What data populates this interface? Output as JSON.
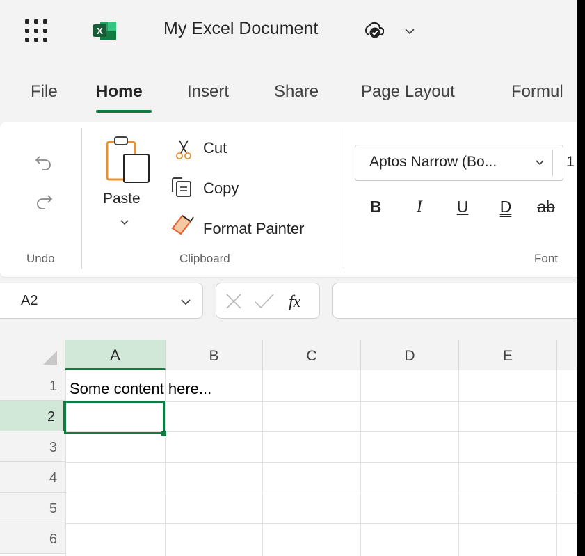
{
  "app": {
    "name": "Excel",
    "icon": "excel-logo-icon",
    "document_title": "My Excel Document",
    "accent_color": "#107c41"
  },
  "menu": {
    "tabs": [
      {
        "label": "File"
      },
      {
        "label": "Home",
        "active": true
      },
      {
        "label": "Insert"
      },
      {
        "label": "Share"
      },
      {
        "label": "Page Layout"
      },
      {
        "label": "Formul"
      }
    ]
  },
  "ribbon": {
    "undo_group": {
      "label": "Undo",
      "undo_icon": "undo-icon",
      "redo_icon": "redo-icon"
    },
    "clipboard_group": {
      "label": "Clipboard",
      "paste": "Paste",
      "cut": "Cut",
      "copy": "Copy",
      "format_painter": "Format Painter"
    },
    "font_group": {
      "label": "Font",
      "font_name": "Aptos Narrow (Bo...",
      "font_size": "1",
      "bold": "B",
      "italic": "I",
      "underline": "U",
      "double_underline": "D",
      "strikethrough": "ab"
    }
  },
  "formula_bar": {
    "name_box": "A2",
    "formula": ""
  },
  "sheet": {
    "columns": [
      "A",
      "B",
      "C",
      "D",
      "E"
    ],
    "rows": [
      "1",
      "2",
      "3",
      "4",
      "5",
      "6"
    ],
    "selected_column": "A",
    "selected_row": "2",
    "cells": {
      "A1": "Some content here..."
    }
  }
}
